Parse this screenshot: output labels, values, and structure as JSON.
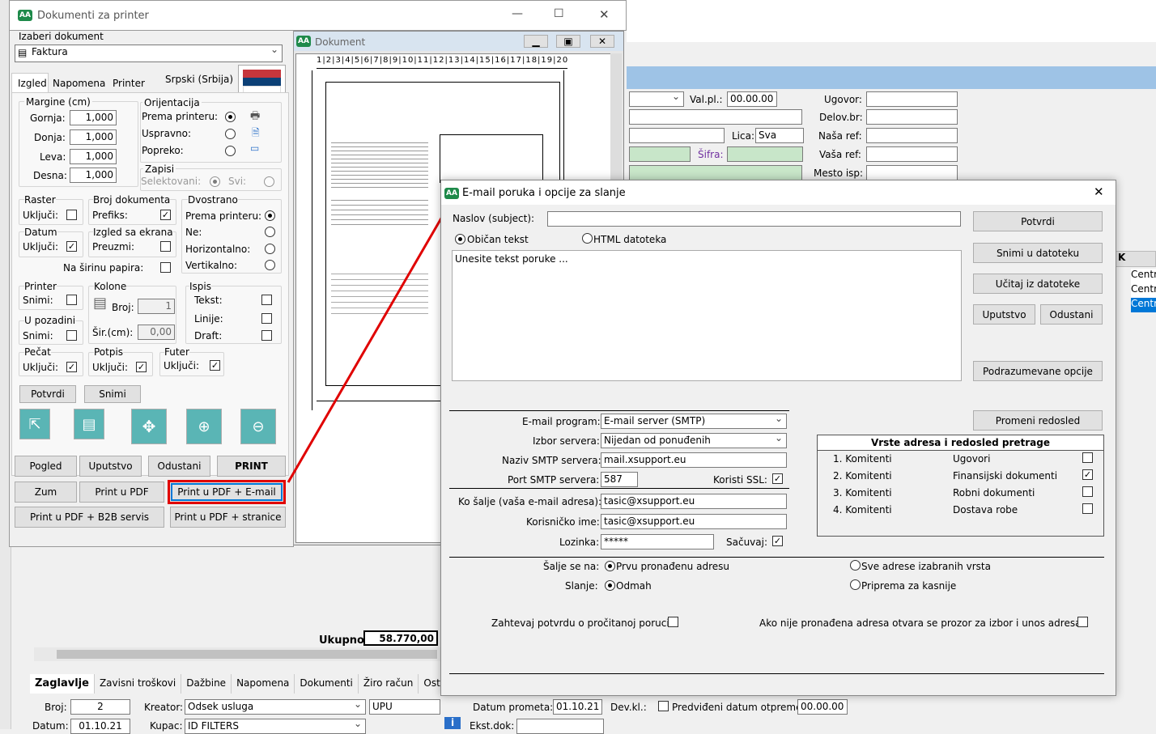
{
  "bg": {
    "valpl_label": "Val.pl.:",
    "valpl": "00.00.00",
    "ugovor": "Ugovor:",
    "delovbr": "Delov.br:",
    "lica_label": "Lica:",
    "lica": "Sva",
    "nasaref": "Naša ref:",
    "vasaref": "Vaša ref:",
    "sifra": "Šifra:",
    "mestoisp": "Mesto isp:",
    "k": "K",
    "cent": "Centr",
    "ukupno_label": "Ukupno:",
    "ukupno": "58.770,00",
    "tabs": [
      "Zaglavlje",
      "Zavisni troškovi",
      "Dažbine",
      "Napomena",
      "Dokumenti",
      "Žiro račun",
      "Ost"
    ],
    "broj_label": "Broj:",
    "broj": "2",
    "kreator_label": "Kreator:",
    "kreator": "Odsek usluga",
    "upu": "UPU",
    "datum_label": "Datum:",
    "datum": "01.10.21",
    "kupac_label": "Kupac:",
    "kupac": "ID FILTERS",
    "ekst": "Ekst.dok:",
    "datumprom_label": "Datum prometa:",
    "datumprom": "01.10.21",
    "devkl": "Dev.kl.:",
    "predv": "Predviđeni datum otpreme",
    "predv_val": "00.00.00"
  },
  "printer": {
    "title": "Dokumenti za printer",
    "izaberi": "Izaberi dokument",
    "doc": "Faktura",
    "tabs": [
      "Izgled",
      "Napomena",
      "Printer"
    ],
    "lang": "Srpski (Srbija)",
    "margine": "Margine (cm)",
    "gornja": "Gornja:",
    "donja": "Donja:",
    "leva": "Leva:",
    "desna": "Desna:",
    "gornja_v": "1,000",
    "donja_v": "1,000",
    "leva_v": "1,000",
    "desna_v": "1,000",
    "orijentacija": "Orijentacija",
    "prema": "Prema printeru:",
    "uspravno": "Uspravno:",
    "popreko": "Popreko:",
    "zapisi": "Zapisi",
    "selektovani": "Selektovani:",
    "svi": "Svi:",
    "raster": "Raster",
    "ukljuci": "Uključi:",
    "brojdok": "Broj dokumenta",
    "prefiks": "Prefiks:",
    "dvostrano": "Dvostrano",
    "prema2": "Prema printeru:",
    "ne": "Ne:",
    "horiz": "Horizontalno:",
    "vert": "Vertikalno:",
    "datum": "Datum",
    "izgled_ekr": "Izgled sa ekrana",
    "preuzmi": "Preuzmi:",
    "nasirinu": "Na širinu papira:",
    "printer_g": "Printer",
    "snimi": "Snimi:",
    "kolone": "Kolone",
    "broj": "Broj:",
    "broj_v": "1",
    "sir": "Šir.(cm):",
    "sir_v": "0,00",
    "ispis": "Ispis",
    "tekst": "Tekst:",
    "linije": "Linije:",
    "draft": "Draft:",
    "upozadini": "U pozadini",
    "pecat": "Pečat",
    "potpis": "Potpis",
    "futer": "Futer",
    "potvrdi": "Potvrdi",
    "snimi_btn": "Snimi",
    "b1": "Pogled",
    "b2": "Uputstvo",
    "b3": "Odustani",
    "b4": "PRINT",
    "b5": "Zum",
    "b6": "Print u PDF",
    "b7": "Print u PDF + E-mail",
    "b8": "Print u PDF + B2B servis",
    "b9": "Print u PDF + stranice"
  },
  "preview": {
    "title": "Dokument"
  },
  "email": {
    "title": "E-mail poruka i opcije za slanje",
    "naslov": "Naslov (subject):",
    "obican": "Običan tekst",
    "html": "HTML datoteka",
    "body": "Unesite tekst poruke ...",
    "potvrdi": "Potvrdi",
    "snimi": "Snimi u datoteku",
    "ucitaj": "Učitaj iz datoteke",
    "uputstvo": "Uputstvo",
    "odustani": "Odustani",
    "podraz": "Podrazumevane opcije",
    "promeni": "Promeni redosled",
    "program_label": "E-mail program:",
    "program": "E-mail server (SMTP)",
    "izbor_label": "Izbor servera:",
    "izbor": "Nijedan od ponuđenih",
    "smtp_label": "Naziv SMTP servera:",
    "smtp": "mail.xsupport.eu",
    "port_label": "Port SMTP servera:",
    "port": "587",
    "ssl": "Koristi SSL:",
    "ko_label": "Ko šalje (vaša e-mail adresa):",
    "ko": "tasic@xsupport.eu",
    "kor_label": "Korisničko ime:",
    "kor": "tasic@xsupport.eu",
    "loz_label": "Lozinka:",
    "loz": "*****",
    "sacuvaj": "Sačuvaj:",
    "vrste": "Vrste adresa i redosled pretrage",
    "rows": [
      {
        "a": "1. Komitenti",
        "b": "Ugovori",
        "c": ""
      },
      {
        "a": "2. Komitenti",
        "b": "Finansijski dokumenti",
        "c": "✓"
      },
      {
        "a": "3. Komitenti",
        "b": "Robni dokumenti",
        "c": ""
      },
      {
        "a": "4. Komitenti",
        "b": "Dostava robe",
        "c": ""
      }
    ],
    "salje": "Šalje se na:",
    "prvu": "Prvu pronađenu adresu",
    "sve": "Sve adrese izabranih vrsta",
    "slanje": "Slanje:",
    "odmah": "Odmah",
    "priprema": "Priprema za kasnije",
    "zahtevaj": "Zahtevaj potvrdu o pročitanoj poruci:",
    "akonije": "Ako nije pronađena adresa otvara se prozor za izbor i unos adresa:"
  }
}
